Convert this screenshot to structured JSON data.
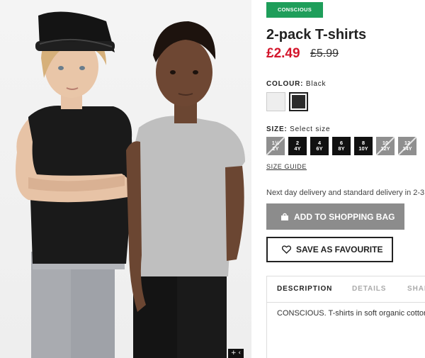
{
  "product": {
    "badge": "CONSCIOUS",
    "title": "2-pack T-shirts",
    "price_now": "£2.49",
    "price_was": "£5.99"
  },
  "colour": {
    "label": "COLOUR:",
    "selected": "Black",
    "swatches": [
      {
        "name": "Light grey",
        "hex": "#eeeeee",
        "selected": false
      },
      {
        "name": "Black",
        "hex": "#2b2b2b",
        "selected": true
      }
    ]
  },
  "size": {
    "label": "SIZE:",
    "hint": "Select size",
    "options": [
      {
        "top": "1½",
        "bottom": "2Y",
        "available": false
      },
      {
        "top": "2",
        "bottom": "4Y",
        "available": true
      },
      {
        "top": "4",
        "bottom": "6Y",
        "available": true
      },
      {
        "top": "6",
        "bottom": "8Y",
        "available": true
      },
      {
        "top": "8",
        "bottom": "10Y",
        "available": true
      },
      {
        "top": "10",
        "bottom": "12Y",
        "available": false
      },
      {
        "top": "12",
        "bottom": "14Y",
        "available": false
      }
    ],
    "guide": "SIZE GUIDE"
  },
  "delivery_text": "Next day delivery and standard delivery in 2-3",
  "actions": {
    "add_to_bag": "ADD TO SHOPPING BAG",
    "save_favourite": "SAVE AS FAVOURITE"
  },
  "tabs": {
    "description": "DESCRIPTION",
    "details": "DETAILS",
    "share": "SHAR"
  },
  "description_text": "CONSCIOUS. T-shirts in soft organic cotton",
  "photo": {
    "zoom_glyph": "+ ‹"
  },
  "colors": {
    "badge_green": "#1e9e5a",
    "price_red": "#d3162c",
    "button_grey": "#8c8c8c"
  }
}
